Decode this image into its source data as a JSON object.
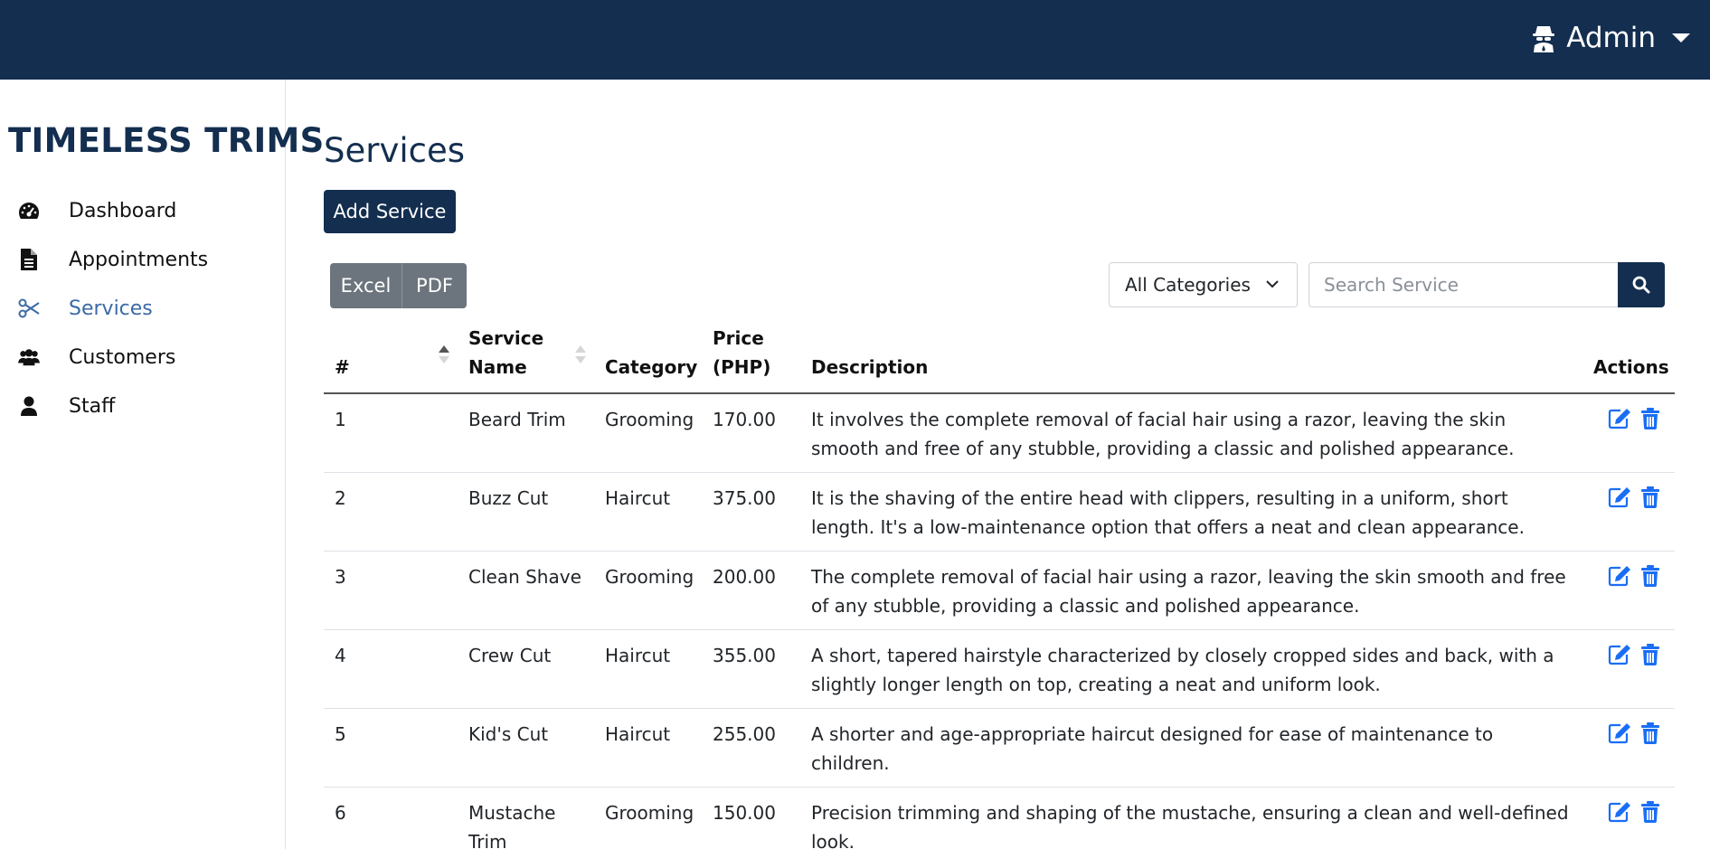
{
  "header": {
    "user_label": "Admin",
    "user_icon": "user-secret-icon"
  },
  "sidebar": {
    "brand": "TIMELESS TRIMS",
    "items": [
      {
        "label": "Dashboard",
        "icon": "tachometer-icon"
      },
      {
        "label": "Appointments",
        "icon": "file-text-icon"
      },
      {
        "label": "Services",
        "icon": "scissors-icon",
        "active": true
      },
      {
        "label": "Customers",
        "icon": "users-icon"
      },
      {
        "label": "Staff",
        "icon": "user-icon"
      }
    ]
  },
  "main": {
    "title": "Services",
    "add_label": "Add Service",
    "export_excel": "Excel",
    "export_pdf": "PDF",
    "category_selected": "All Categories",
    "search_placeholder": "Search Service"
  },
  "table": {
    "columns": {
      "num": "#",
      "name": "Service Name",
      "category": "Category",
      "price": "Price (PHP)",
      "description": "Description",
      "actions": "Actions"
    },
    "rows": [
      {
        "num": "1",
        "name": "Beard Trim",
        "category": "Grooming",
        "price": "170.00",
        "description": "It involves the complete removal of facial hair using a razor, leaving the skin smooth and free of any stubble, providing a classic and polished appearance."
      },
      {
        "num": "2",
        "name": "Buzz Cut",
        "category": "Haircut",
        "price": "375.00",
        "description": "It is the shaving of the entire head with clippers, resulting in a uniform, short length. It's a low-maintenance option that offers a neat and clean appearance."
      },
      {
        "num": "3",
        "name": "Clean Shave",
        "category": "Grooming",
        "price": "200.00",
        "description": "The complete removal of facial hair using a razor, leaving the skin smooth and free of any stubble, providing a classic and polished appearance."
      },
      {
        "num": "4",
        "name": "Crew Cut",
        "category": "Haircut",
        "price": "355.00",
        "description": "A short, tapered hairstyle characterized by closely cropped sides and back, with a slightly longer length on top, creating a neat and uniform look."
      },
      {
        "num": "5",
        "name": "Kid's Cut",
        "category": "Haircut",
        "price": "255.00",
        "description": "A shorter and age-appropriate haircut designed for ease of maintenance to children."
      },
      {
        "num": "6",
        "name": "Mustache Trim",
        "category": "Grooming",
        "price": "150.00",
        "description": "Precision trimming and shaping of the mustache, ensuring a clean and well-defined look."
      }
    ]
  },
  "colors": {
    "navy": "#132e4f",
    "active_link": "#3b6aa6",
    "action_icon": "#1a6ef5",
    "export_button": "#6c757d"
  }
}
